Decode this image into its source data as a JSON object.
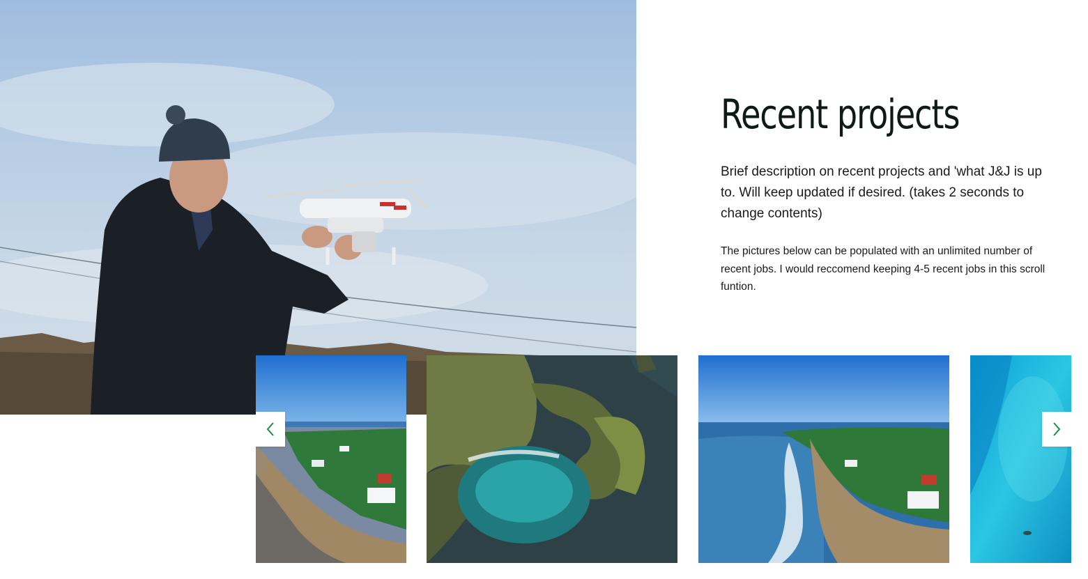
{
  "section": {
    "title": "Recent projects",
    "lead": "Brief description on recent projects and 'what J&J is up to. Will keep updated if desired. (takes 2 seconds to change contents)",
    "note": "The pictures below can be populated with an unlimited number of recent jobs. I would reccomend keeping 4-5 recent jobs in this scroll funtion."
  },
  "hero_image": {
    "icon": "drone-operator-photo"
  },
  "carousel": {
    "prev_icon": "chevron-left-icon",
    "next_icon": "chevron-right-icon",
    "slides": [
      {
        "icon": "coastal-town-photo"
      },
      {
        "icon": "island-cliff-photo"
      },
      {
        "icon": "beach-coastline-photo"
      },
      {
        "icon": "turquoise-sea-photo"
      }
    ]
  },
  "colors": {
    "accent": "#1e8a4a",
    "heading": "#0e1a14",
    "text": "#1a1a1a"
  }
}
